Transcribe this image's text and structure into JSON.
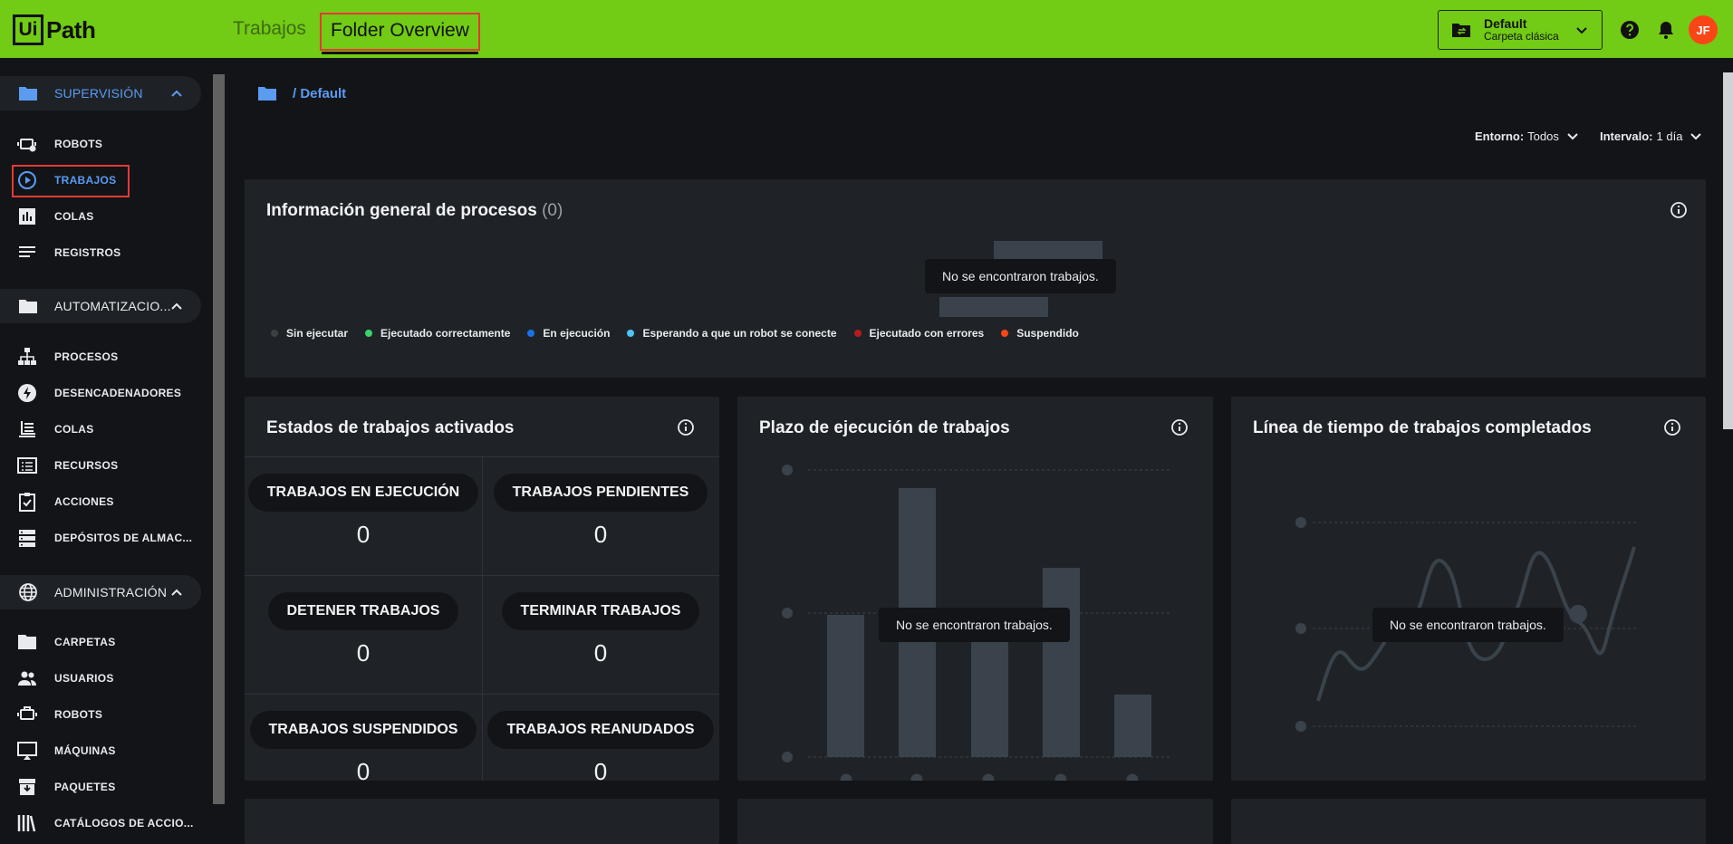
{
  "topbar": {
    "logo_box": "Ui",
    "logo_text": "Path",
    "tabs": [
      "Trabajos",
      "Folder Overview"
    ],
    "folder": {
      "name": "Default",
      "type": "Carpeta clásica"
    },
    "avatar": "JF",
    "accent": "#72cb14"
  },
  "sidebar": {
    "sections": [
      {
        "label": "SUPERVISIÓN",
        "items": [
          "ROBOTS",
          "TRABAJOS",
          "COLAS",
          "REGISTROS"
        ]
      },
      {
        "label": "AUTOMATIZACIO...",
        "items": [
          "PROCESOS",
          "DESENCADENADORES",
          "COLAS",
          "RECURSOS",
          "ACCIONES",
          "DEPÓSITOS DE ALMAC..."
        ]
      },
      {
        "label": "ADMINISTRACIÓN",
        "items": [
          "CARPETAS",
          "USUARIOS",
          "ROBOTS",
          "MÁQUINAS",
          "PAQUETES",
          "CATÁLOGOS DE ACCIO..."
        ]
      }
    ],
    "active_item": "TRABAJOS"
  },
  "breadcrumb": "/ Default",
  "filters": {
    "env_label": "Entorno:",
    "env_value": "Todos",
    "interval_label": "Intervalo:",
    "interval_value": "1 día"
  },
  "process_card": {
    "title": "Información general de procesos",
    "count": "(0)",
    "empty": "No se encontraron trabajos.",
    "legend": [
      {
        "label": "Sin ejecutar",
        "color": "#3c4043"
      },
      {
        "label": "Ejecutado correctamente",
        "color": "#38d36a"
      },
      {
        "label": "En ejecución",
        "color": "#1a73e8"
      },
      {
        "label": "Esperando a que un robot se conecte",
        "color": "#4fc3f7"
      },
      {
        "label": "Ejecutado con errores",
        "color": "#b71c1c"
      },
      {
        "label": "Suspendido",
        "color": "#fa4616"
      }
    ]
  },
  "states_card": {
    "title": "Estados de trabajos activados",
    "cells": [
      {
        "label": "TRABAJOS EN EJECUCIÓN",
        "value": "0"
      },
      {
        "label": "TRABAJOS PENDIENTES",
        "value": "0"
      },
      {
        "label": "DETENER TRABAJOS",
        "value": "0"
      },
      {
        "label": "TERMINAR TRABAJOS",
        "value": "0"
      },
      {
        "label": "TRABAJOS SUSPENDIDOS",
        "value": "0"
      },
      {
        "label": "TRABAJOS REANUDADOS",
        "value": "0"
      }
    ]
  },
  "duration_card": {
    "title": "Plazo de ejecución de trabajos",
    "empty": "No se encontraron trabajos."
  },
  "timeline_card": {
    "title": "Línea de tiempo de trabajos completados",
    "empty": "No se encontraron trabajos."
  }
}
